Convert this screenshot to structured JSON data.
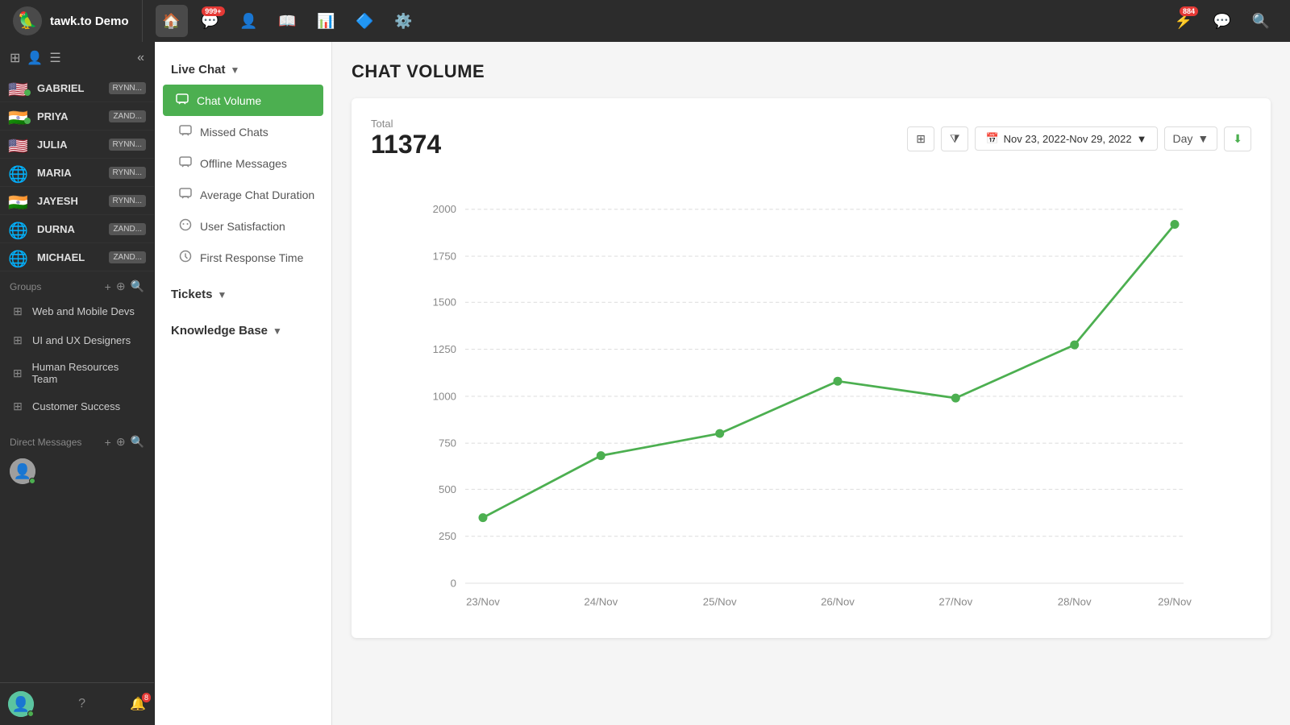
{
  "app": {
    "name": "tawk.to Demo",
    "logo_emoji": "🦜"
  },
  "top_nav": {
    "badge_count": "999+",
    "badge_count2": "884",
    "buttons": [
      {
        "id": "home",
        "icon": "🏠",
        "active": false
      },
      {
        "id": "chat",
        "icon": "💬",
        "badge": "999+",
        "active": false
      },
      {
        "id": "contacts",
        "icon": "👤",
        "active": false
      },
      {
        "id": "book",
        "icon": "📖",
        "active": false
      },
      {
        "id": "analytics",
        "icon": "📊",
        "active": true
      },
      {
        "id": "monitor",
        "icon": "🔷",
        "active": false
      },
      {
        "id": "settings",
        "icon": "⚙️",
        "active": false
      }
    ],
    "right_buttons": [
      {
        "id": "notifications",
        "icon": "⚡",
        "badge": "884"
      },
      {
        "id": "messages",
        "icon": "💬"
      },
      {
        "id": "search",
        "icon": "🔍"
      }
    ]
  },
  "sidebar": {
    "header_count": "7",
    "contacts": [
      {
        "name": "GABRIEL",
        "label": "RYNN...",
        "flag": "🇺🇸",
        "online": true
      },
      {
        "name": "PRIYA",
        "label": "ZAND...",
        "flag": "🇮🇳",
        "online": true
      },
      {
        "name": "JULIA",
        "label": "RYNN...",
        "flag": "🇺🇸",
        "online": false
      },
      {
        "name": "MARIA",
        "label": "RYNN...",
        "flag": "🌐",
        "online": false
      },
      {
        "name": "JAYESH",
        "label": "RYNN...",
        "flag": "🇮🇳",
        "online": false
      },
      {
        "name": "DURNA",
        "label": "ZAND...",
        "flag": "🌐",
        "online": false
      },
      {
        "name": "MICHAEL",
        "label": "ZAND...",
        "flag": "🌐",
        "online": false
      }
    ],
    "groups_title": "Groups",
    "groups": [
      {
        "name": "Web and Mobile Devs"
      },
      {
        "name": "UI and UX Designers"
      },
      {
        "name": "Human Resources Team"
      },
      {
        "name": "Customer Success"
      }
    ],
    "direct_messages_title": "Direct Messages"
  },
  "analytics_nav": {
    "live_chat": {
      "label": "Live Chat",
      "arrow": "▼",
      "items": [
        {
          "id": "chat-volume",
          "label": "Chat Volume",
          "active": true,
          "icon": "💬"
        },
        {
          "id": "missed-chats",
          "label": "Missed Chats",
          "active": false,
          "icon": "💬"
        },
        {
          "id": "offline-messages",
          "label": "Offline Messages",
          "active": false,
          "icon": "💬"
        },
        {
          "id": "avg-chat-duration",
          "label": "Average Chat Duration",
          "active": false,
          "icon": "💬"
        },
        {
          "id": "user-satisfaction",
          "label": "User Satisfaction",
          "active": false,
          "icon": "👥"
        },
        {
          "id": "first-response",
          "label": "First Response Time",
          "active": false,
          "icon": "🕐"
        }
      ]
    },
    "tickets": {
      "label": "Tickets",
      "arrow": "▼"
    },
    "knowledge_base": {
      "label": "Knowledge Base",
      "arrow": "▼"
    }
  },
  "chart": {
    "title": "CHAT VOLUME",
    "total_label": "Total",
    "total_value": "11374",
    "date_range": "Nov 23, 2022-Nov 29, 2022",
    "period": "Day",
    "data_points": [
      {
        "date": "23/Nov",
        "value": 350
      },
      {
        "date": "24/Nov",
        "value": 680
      },
      {
        "date": "25/Nov",
        "value": 800
      },
      {
        "date": "26/Nov",
        "value": 1080
      },
      {
        "date": "27/Nov",
        "value": 990
      },
      {
        "date": "28/Nov",
        "value": 1275
      },
      {
        "date": "29/Nov",
        "value": 1920
      }
    ],
    "y_labels": [
      "0",
      "250",
      "500",
      "750",
      "1000",
      "1250",
      "1500",
      "1750",
      "2000"
    ],
    "color": "#4caf50"
  }
}
